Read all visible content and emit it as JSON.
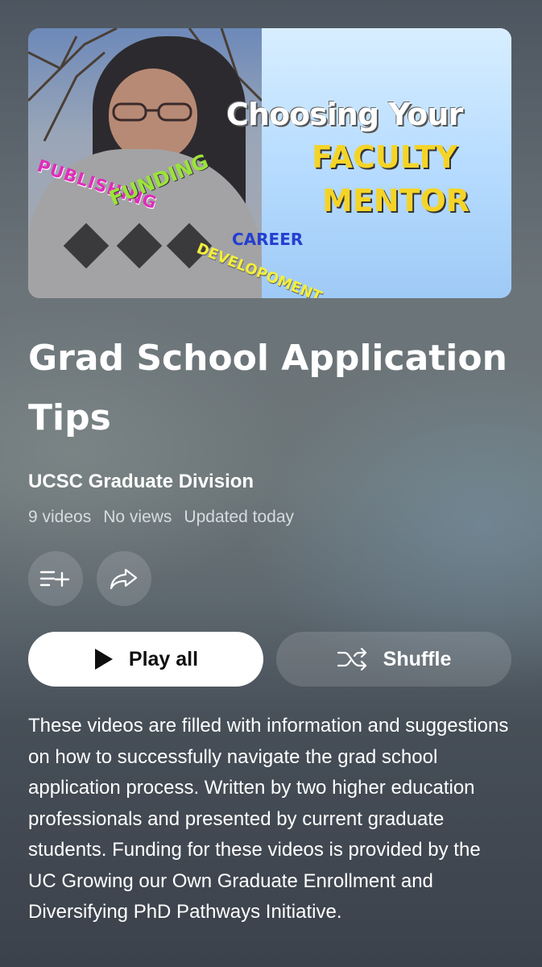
{
  "thumbnail": {
    "title_line1": "Choosing Your",
    "title_line2": "FACULTY",
    "title_line3": "MENTOR",
    "tag_publishing": "PUBLISHING",
    "tag_funding": "FUNDING",
    "tag_career": "CAREER",
    "tag_development": "DEVELOPOMENT"
  },
  "playlist": {
    "title": "Grad School Application Tips",
    "channel": "UCSC Graduate Division",
    "video_count": "9 videos",
    "views": "No views",
    "updated": "Updated today"
  },
  "actions": {
    "save_icon": "playlist-add-icon",
    "share_icon": "share-icon"
  },
  "buttons": {
    "play_all": "Play all",
    "shuffle": "Shuffle"
  },
  "description": "These videos are filled with information and suggestions on how to successfully navigate the grad school application process. Written by two higher education professionals and presented by current graduate students. Funding for these videos is provided by the UC Growing our Own Graduate Enrollment and Diversifying PhD Pathways Initiative."
}
